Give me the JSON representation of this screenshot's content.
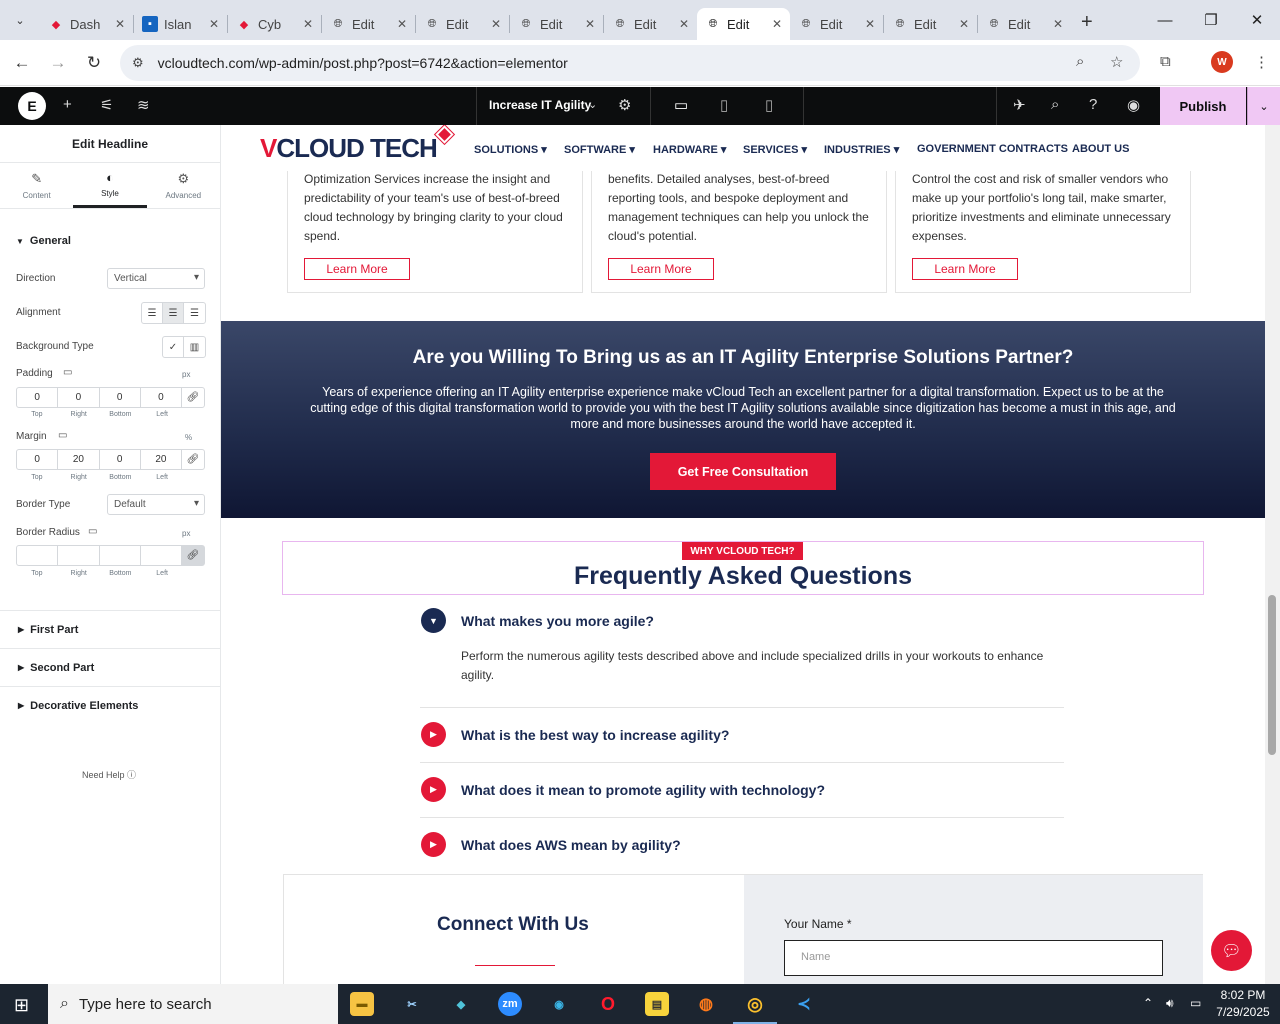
{
  "browser": {
    "tabs": [
      {
        "label": "Dash",
        "icon": "diamond-icon",
        "active": false
      },
      {
        "label": "Islan",
        "icon": "square-icon",
        "active": false
      },
      {
        "label": "Cyb",
        "icon": "diamond-icon",
        "active": false
      },
      {
        "label": "Edit",
        "icon": "globe-icon",
        "active": false
      },
      {
        "label": "Edit",
        "icon": "globe-icon",
        "active": false
      },
      {
        "label": "Edit",
        "icon": "globe-icon",
        "active": false
      },
      {
        "label": "Edit",
        "icon": "globe-icon",
        "active": false
      },
      {
        "label": "Edit",
        "icon": "globe-icon",
        "active": true
      },
      {
        "label": "Edit",
        "icon": "globe-icon",
        "active": false
      },
      {
        "label": "Edit",
        "icon": "globe-icon",
        "active": false
      },
      {
        "label": "Edit",
        "icon": "globe-icon",
        "active": false
      }
    ],
    "url": "vcloudtech.com/wp-admin/post.php?post=6742&action=elementor",
    "profile_initial": "W"
  },
  "elementor": {
    "page_title": "Increase IT Agility",
    "publish_label": "Publish"
  },
  "panel": {
    "header": "Edit Headline",
    "tabs": [
      "Content",
      "Style",
      "Advanced"
    ],
    "section_general": "General",
    "direction_label": "Direction",
    "direction_value": "Vertical",
    "alignment_label": "Alignment",
    "background_type_label": "Background Type",
    "padding_label": "Padding",
    "padding_unit": "px",
    "padding_values": [
      "0",
      "0",
      "0",
      "0"
    ],
    "margin_label": "Margin",
    "margin_unit": "%",
    "margin_values": [
      "0",
      "20",
      "0",
      "20"
    ],
    "dim_labels": [
      "Top",
      "Right",
      "Bottom",
      "Left"
    ],
    "border_type_label": "Border Type",
    "border_type_value": "Default",
    "border_radius_label": "Border Radius",
    "border_radius_unit": "px",
    "accordions": [
      "First Part",
      "Second Part",
      "Decorative Elements"
    ],
    "need_help": "Need Help"
  },
  "site": {
    "logo_v": "V",
    "logo_rest": "CLOUD TECH",
    "nav": [
      "SOLUTIONS",
      "SOFTWARE",
      "HARDWARE",
      "SERVICES",
      "INDUSTRIES",
      "GOVERNMENT CONTRACTS",
      "ABOUT US"
    ],
    "cards": [
      {
        "text": "Optimization Services increase the insight and predictability of your team's use of best-of-breed cloud technology by bringing clarity to your cloud spend.",
        "button": "Learn More"
      },
      {
        "text": "benefits. Detailed analyses, best-of-breed reporting tools, and bespoke deployment and management techniques can help you unlock the cloud's potential.",
        "button": "Learn More"
      },
      {
        "text": "Control the cost and risk of smaller vendors who make up your portfolio's long tail, make smarter, prioritize investments and eliminate unnecessary expenses.",
        "button": "Learn More"
      }
    ],
    "cta_title": "Are you Willing To Bring us as an IT Agility Enterprise Solutions Partner?",
    "cta_text": "Years of experience offering an IT Agility enterprise experience make vCloud Tech an excellent partner for a digital transformation. Expect us to be at the cutting edge of this digital transformation world to provide you with the best IT Agility solutions available since digitization has become a must in this age, and more and more businesses around the world have accepted it.",
    "cta_button": "Get Free Consultation",
    "faq_badge": "WHY VCLOUD TECH?",
    "faq_title": "Frequently Asked Questions",
    "faqs": [
      {
        "q": "What makes you more agile?",
        "a": "Perform the numerous agility tests described above and include specialized drills in your workouts to enhance agility."
      },
      {
        "q": "What is the best way to increase agility?"
      },
      {
        "q": "What does it mean to promote agility with technology?"
      },
      {
        "q": "What does AWS mean by agility?"
      }
    ],
    "connect_title": "Connect With Us",
    "name_label": "Your Name *",
    "name_placeholder": "Name"
  },
  "taskbar": {
    "search_text": "Type here to search",
    "time": "8:02 PM",
    "date": "7/29/2025"
  },
  "colors": {
    "brand_red": "#e31837",
    "brand_navy": "#1a2a52",
    "publish_bg": "#f0c8f4"
  }
}
